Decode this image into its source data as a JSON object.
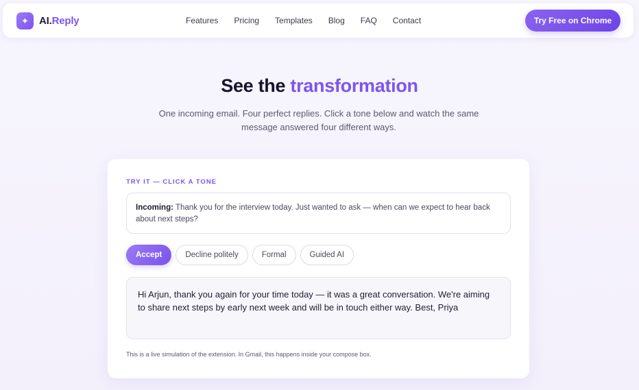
{
  "brand": {
    "logo_icon": "sparkle-icon",
    "name_main": "AI.",
    "name_accent": "Reply"
  },
  "nav": {
    "links": [
      "Features",
      "Pricing",
      "Templates",
      "Blog",
      "FAQ",
      "Contact"
    ],
    "cta_label": "Try Free on Chrome"
  },
  "hero": {
    "title_main": "See the",
    "title_accent": "transformation",
    "subtitle": "One incoming email. Four perfect replies. Click a tone below and watch the same message answered four different ways."
  },
  "demo": {
    "label": "TRY IT — CLICK A TONE",
    "incoming_prefix": "Incoming:",
    "incoming_text": "Thank you for the interview today. Just wanted to ask — when can we expect to hear back about next steps?",
    "tones": [
      "Accept",
      "Decline politely",
      "Formal",
      "Guided AI"
    ],
    "active_tone": "Accept",
    "reply_text": "Hi Arjun, thank you again for your time today — it was a great conversation. We're aiming to share next steps by early next week and will be in touch either way. Best, Priya",
    "footnote": "This is a live simulation of the extension. In Gmail, this happens inside your compose box."
  },
  "colors": {
    "accent": "#7c55ee",
    "background": "#f5f3fc"
  }
}
